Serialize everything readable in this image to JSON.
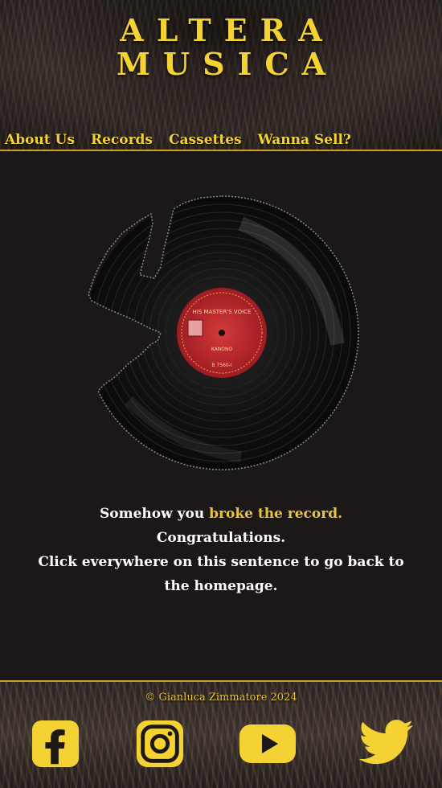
{
  "header": {
    "logo_line1": "ALTERA",
    "logo_line2": "MUSICA"
  },
  "nav": {
    "items": [
      {
        "label": "About Us"
      },
      {
        "label": "Records"
      },
      {
        "label": "Cassettes"
      },
      {
        "label": "Wanna Sell?"
      }
    ]
  },
  "record": {
    "label_text": "KANONO",
    "label_code": "B 7560-I"
  },
  "message": {
    "part1": "Somehow you ",
    "highlight": "broke the record.",
    "line2": "Congratulations.",
    "line3": "Click everywhere on this sentence to go back to the homepage."
  },
  "footer": {
    "copyright": "© Gianluca Zimmatore 2024",
    "social": [
      "facebook-icon",
      "instagram-icon",
      "youtube-icon",
      "twitter-icon"
    ]
  },
  "colors": {
    "accent": "#f4d233",
    "background": "#1c1818",
    "record_label": "#c0282e"
  }
}
